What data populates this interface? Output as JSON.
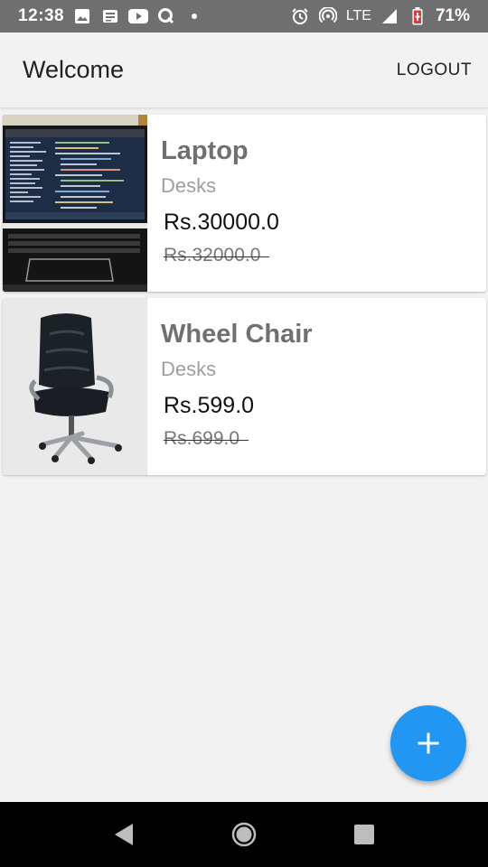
{
  "status_bar": {
    "time": "12:38",
    "network": "LTE",
    "battery": "71%",
    "left_icons": [
      "gallery-icon",
      "news-icon",
      "youtube-icon",
      "q-icon",
      "dot-icon"
    ],
    "right_icons": [
      "alarm-icon",
      "hotspot-icon",
      "signal-icon",
      "battery-icon"
    ]
  },
  "app_bar": {
    "title": "Welcome",
    "logout_label": "LOGOUT"
  },
  "products": [
    {
      "name": "Laptop",
      "category": "Desks",
      "price": "Rs.30000.0",
      "old_price": "Rs.32000.0"
    },
    {
      "name": "Wheel Chair",
      "category": "Desks",
      "price": "Rs.599.0",
      "old_price": "Rs.699.0"
    }
  ],
  "fab": {
    "icon": "plus-icon",
    "color": "#2196f3"
  },
  "nav_bar": {
    "icons": [
      "back-icon",
      "home-icon",
      "recents-icon"
    ]
  },
  "colors": {
    "status_bar": "#6f6f6f",
    "background": "#f2f2f2",
    "accent": "#2196f3"
  }
}
